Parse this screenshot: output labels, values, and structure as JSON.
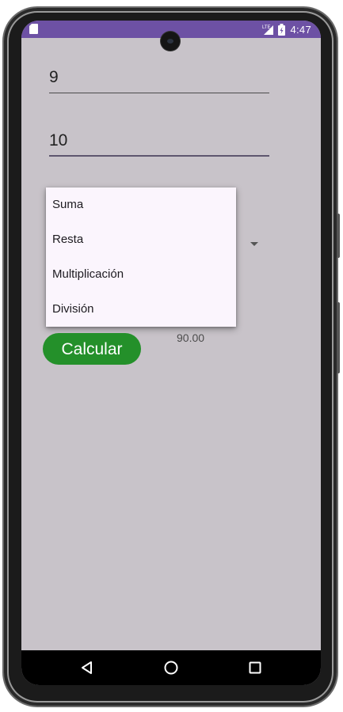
{
  "status_bar": {
    "time": "4:47",
    "network": "LTE",
    "icons": [
      "sd-card-icon",
      "lte-signal-icon",
      "battery-icon"
    ],
    "color": "#6d51a4"
  },
  "form": {
    "first_number": "9",
    "second_number": "10"
  },
  "operation_menu": {
    "options": [
      "Suma",
      "Resta",
      "Multiplicación",
      "División"
    ]
  },
  "calculate_button": {
    "label": "Calcular",
    "color": "#24902a"
  },
  "result": {
    "value": "90.00"
  },
  "navigation_bar": {
    "icons": [
      "back-icon",
      "home-icon",
      "recents-icon"
    ]
  },
  "colors": {
    "background": "#c8c3c9",
    "menu_background": "#fbf5fd"
  }
}
